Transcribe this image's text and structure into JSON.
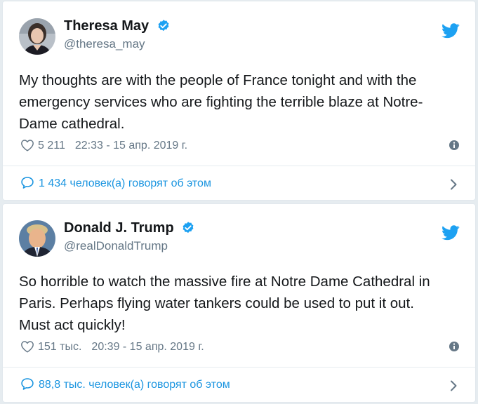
{
  "colors": {
    "twitter_blue": "#1da1f2",
    "link_blue": "#1b95e0",
    "text": "#14171a",
    "muted": "#657786",
    "background": "#e6ecf0"
  },
  "tweets": [
    {
      "display_name": "Theresa May",
      "handle": "@theresa_may",
      "verified": true,
      "text": "My thoughts are with the people of France tonight and with the\nemergency services who are fighting the terrible blaze at Notre-\nDame cathedral.",
      "likes": "5 211",
      "timestamp": "22:33 - 15 апр. 2019 г.",
      "replies_link": "1 434 человек(а) говорят об этом",
      "icons": {
        "like": "heart-icon",
        "info": "info-icon",
        "reply": "speech-bubble-icon",
        "more": "chevron-right-icon",
        "brand": "twitter-bird-icon"
      }
    },
    {
      "display_name": "Donald J. Trump",
      "handle": "@realDonaldTrump",
      "verified": true,
      "text": "So horrible to watch the massive fire at Notre Dame Cathedral in\nParis. Perhaps flying water tankers could be used to put it out.\nMust act quickly!",
      "likes": "151 тыс.",
      "timestamp": "20:39 - 15 апр. 2019 г.",
      "replies_link": "88,8 тыс. человек(а) говорят об этом",
      "icons": {
        "like": "heart-icon",
        "info": "info-icon",
        "reply": "speech-bubble-icon",
        "more": "chevron-right-icon",
        "brand": "twitter-bird-icon"
      }
    }
  ]
}
